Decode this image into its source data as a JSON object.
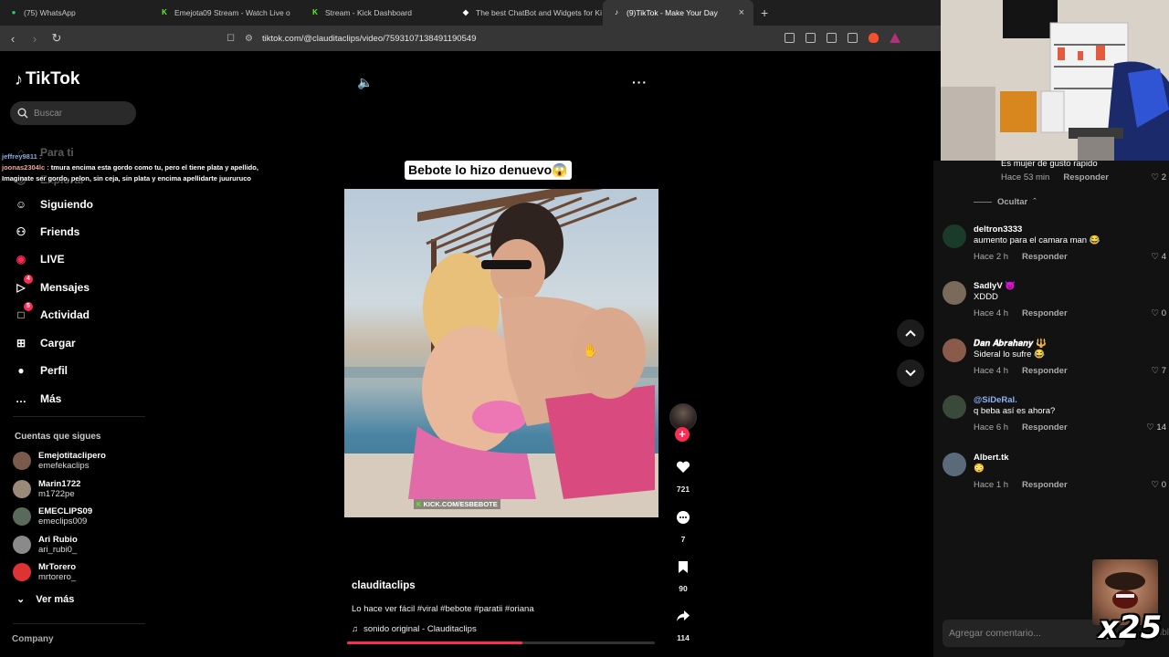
{
  "browser": {
    "tabs": [
      {
        "label": "(75) WhatsApp",
        "icon": "whatsapp-icon",
        "color": "#25d366"
      },
      {
        "label": "Emejota09 Stream - Watch Live o",
        "icon": "kick-icon",
        "color": "#53fc18"
      },
      {
        "label": "Stream - Kick Dashboard",
        "icon": "kick-icon",
        "color": "#53fc18"
      },
      {
        "label": "The best ChatBot and Widgets for Ki",
        "icon": "botrix-icon",
        "color": "#ffffff"
      },
      {
        "label": "(9)TikTok - Make Your Day",
        "icon": "tiktok-icon",
        "color": "#ffffff"
      }
    ],
    "url": "tiktok.com/@clauditaclips/video/7593107138491190549"
  },
  "sidebar": {
    "logo": "TikTok",
    "search_placeholder": "Buscar",
    "nav": [
      {
        "label": "Para ti",
        "icon": "home-icon",
        "badge": ""
      },
      {
        "label": "Explorar",
        "icon": "compass-icon",
        "badge": ""
      },
      {
        "label": "Siguiendo",
        "icon": "following-icon",
        "badge": ""
      },
      {
        "label": "Friends",
        "icon": "friends-icon",
        "badge": ""
      },
      {
        "label": "LIVE",
        "icon": "live-icon",
        "badge": ""
      },
      {
        "label": "Mensajes",
        "icon": "messages-icon",
        "badge": "4"
      },
      {
        "label": "Actividad",
        "icon": "activity-icon",
        "badge": "5"
      },
      {
        "label": "Cargar",
        "icon": "upload-icon",
        "badge": ""
      },
      {
        "label": "Perfil",
        "icon": "profile-icon",
        "badge": ""
      },
      {
        "label": "Más",
        "icon": "more-icon",
        "badge": ""
      }
    ],
    "following_title": "Cuentas que sigues",
    "following": [
      {
        "name": "Emejotitaclipero",
        "handle": "emefekaclips"
      },
      {
        "name": "Marin1722",
        "handle": "m1722pe"
      },
      {
        "name": "EMECLIPS09",
        "handle": "emeclips009"
      },
      {
        "name": "Ari Rubio",
        "handle": "ari_rubi0_"
      },
      {
        "name": "MrTorero",
        "handle": "mrtorero_"
      }
    ],
    "see_more": "Ver más",
    "company": "Company"
  },
  "chat_overlay": [
    {
      "user": "jeffrey9811 :",
      "text": ""
    },
    {
      "user": "joonas2304lc :",
      "text": "tmura encima esta gordo como tu, pero el tiene plata y apellido, Imaginate ser gordo, pelon, sin ceja, sin plata y encima apellidarte juururuco"
    }
  ],
  "video": {
    "title": "Bebote lo hizo denuevo😱",
    "watermark": "KICK.COM/ESBEBOTE",
    "uploader": "clauditaclips",
    "caption": "Lo hace ver fácil #viral #bebote #paratii #oriana",
    "sound": "sonido original - Clauditaclips",
    "progress": 0.57,
    "likes": "721",
    "comments": "7",
    "saves": "90",
    "shares": "114"
  },
  "comments_panel": {
    "first": {
      "text": "Es mujer de gusto rapido",
      "time": "Hace 53 min",
      "likes": "2"
    },
    "hide_label": "Ocultar",
    "reply_label": "Responder",
    "list": [
      {
        "user": "deltron3333",
        "text": "aumento para el camara man 😂",
        "time": "Hace 2 h",
        "likes": "4",
        "color": "#1a3a2a"
      },
      {
        "user": "SadlyV 👿",
        "text": "XDDD",
        "time": "Hace 4 h",
        "likes": "0",
        "color": "#7a6a5a"
      },
      {
        "user": "𝑫𝒂𝒏 𝑨𝒃𝒓𝒂𝒉𝒂𝒏𝒚 🔱",
        "text": "Sideral lo sufre 😂",
        "time": "Hace 4 h",
        "likes": "7",
        "color": "#8a5a4a"
      },
      {
        "user": "@SiDeRal.",
        "text": "q beba así es ahora?",
        "time": "Hace 6 h",
        "likes": "14",
        "color": "#3a4a3a"
      },
      {
        "user": "Albert.tk",
        "text": "😳",
        "time": "Hace 1 h",
        "likes": "0",
        "color": "#5a6a7a"
      }
    ],
    "add_placeholder": "Agregar comentario...",
    "post_label": "Publicar"
  },
  "overlay": {
    "multiplier": "x25"
  }
}
